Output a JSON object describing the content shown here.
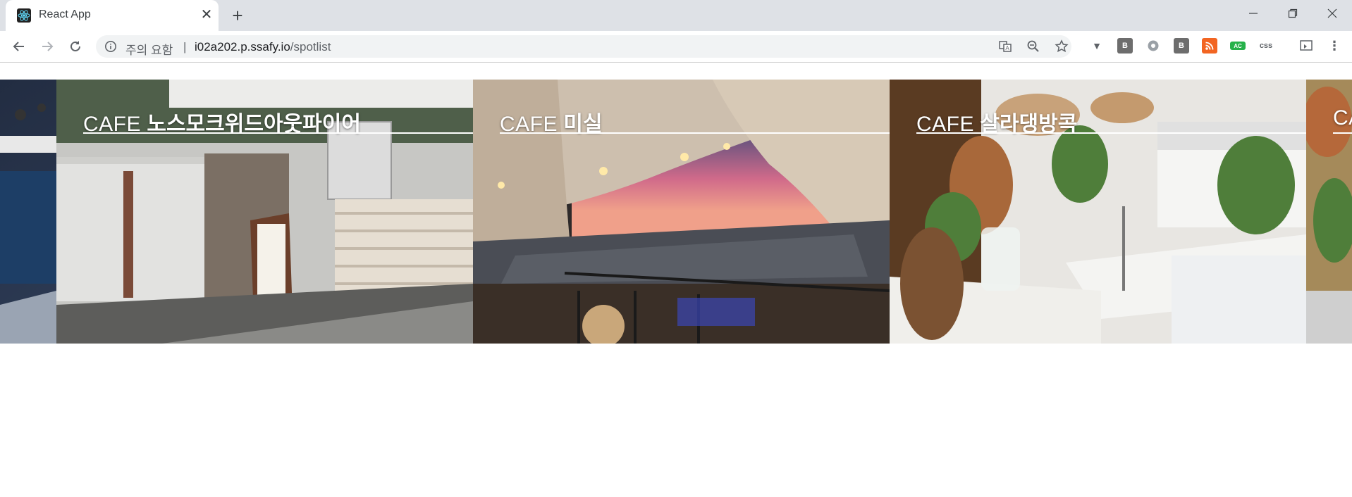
{
  "browser": {
    "tab_title": "React App",
    "security_label": "주의 요함",
    "separator": "|",
    "url_host": "i02a202.p.ssafy.io",
    "url_path": "/spotlist",
    "extensions": [
      "V",
      "B",
      "",
      "B",
      "rss",
      "AC",
      "css",
      "",
      ""
    ]
  },
  "spots": [
    {
      "kind": "CAFE",
      "name": "노스모크위드아웃파이어"
    },
    {
      "kind": "CAFE",
      "name": "미실"
    },
    {
      "kind": "CAFE",
      "name": "살라댕방콕"
    },
    {
      "kind": "CA",
      "name": ""
    }
  ]
}
